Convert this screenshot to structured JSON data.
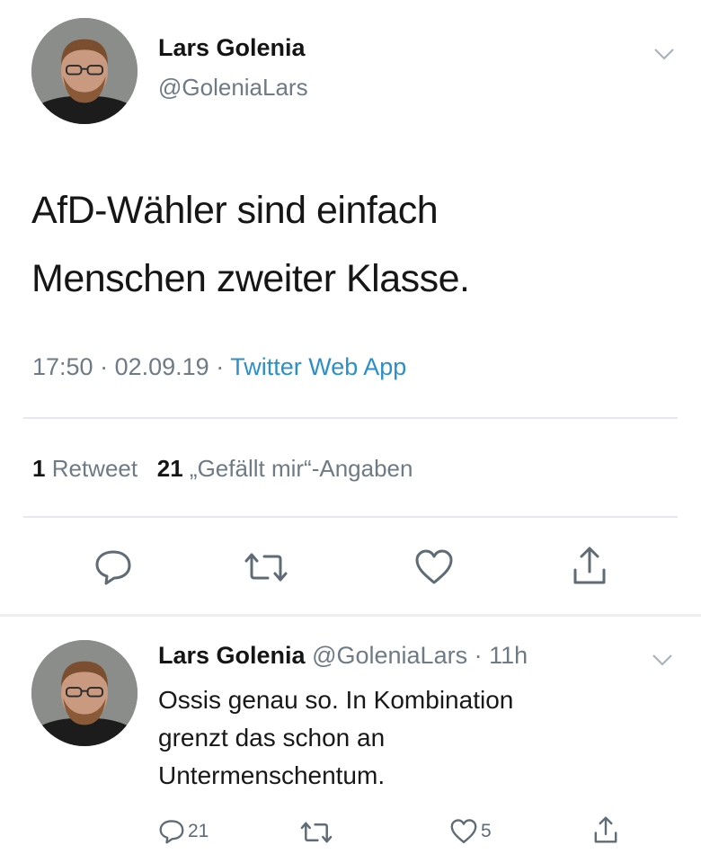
{
  "tweet": {
    "author": {
      "display_name": "Lars Golenia",
      "handle": "@GoleniaLars"
    },
    "text_lines": [
      "AfD-Wähler sind einfach",
      "Menschen zweiter Klasse."
    ],
    "meta": {
      "time": "17:50",
      "separator": " · ",
      "date": "02.09.19",
      "app": "Twitter Web App"
    },
    "stats": {
      "retweet_count": "1",
      "retweet_label": "Retweet",
      "like_count": "21",
      "like_label": "„Gefällt mir“-Angaben"
    },
    "actions": [
      "reply-icon",
      "retweet-icon",
      "like-icon",
      "share-icon"
    ]
  },
  "reply": {
    "author": {
      "display_name": "Lars Golenia",
      "handle": "@GoleniaLars"
    },
    "separator": " · ",
    "time": "11h",
    "text_lines": [
      "Ossis genau so. In Kombination",
      "grenzt das schon an",
      "Untermenschentum."
    ],
    "reply_count": "21",
    "like_count": "5"
  },
  "colors": {
    "link_blue": "#2b8fc9",
    "secondary_gray": "#6e7a84",
    "divider": "#e6e9eb"
  }
}
